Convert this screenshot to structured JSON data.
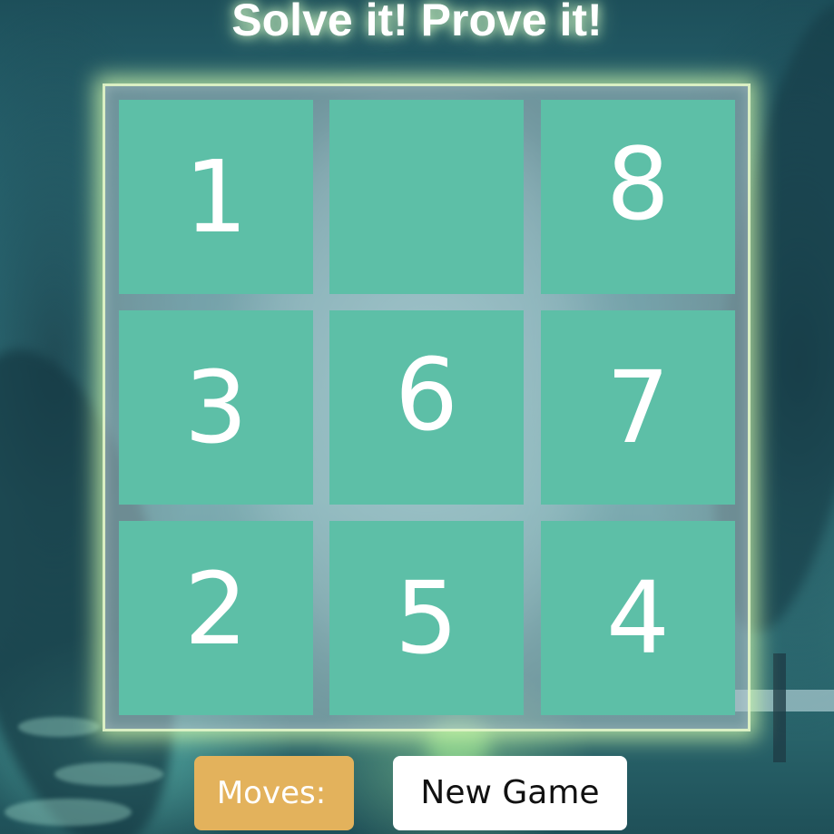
{
  "title": "Solve it! Prove it!",
  "board": {
    "tiles": [
      "1",
      "",
      "8",
      "3",
      "6",
      "7",
      "2",
      "5",
      "4"
    ]
  },
  "moves": {
    "label": "Moves:",
    "count": ""
  },
  "new_game_label": "New Game",
  "colors": {
    "tile": "#5dbfa7",
    "tile_text": "#ffffff",
    "moves_badge": "#e3b25c",
    "button": "#ffffff",
    "board_glow": "#d7ffaf"
  }
}
